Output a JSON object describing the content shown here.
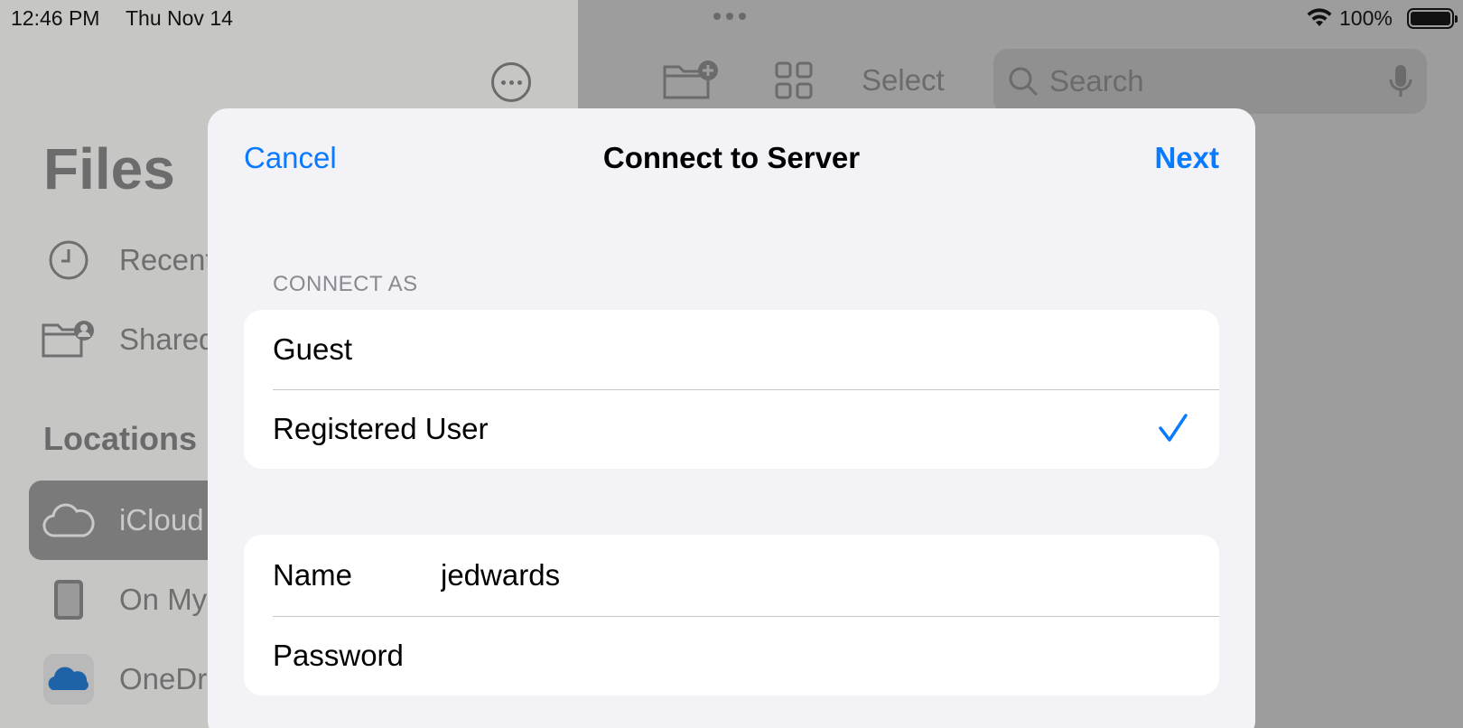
{
  "status_bar": {
    "time": "12:46 PM",
    "date": "Thu Nov 14",
    "battery": "100%"
  },
  "sidebar": {
    "title": "Files",
    "section_locations": "Locations",
    "items": [
      {
        "label": "Recents",
        "icon": "clock-icon"
      },
      {
        "label": "Shared",
        "icon": "shared-folder-icon"
      },
      {
        "label": "iCloud",
        "icon": "cloud-icon",
        "selected": true
      },
      {
        "label": "On My",
        "icon": "ipad-icon"
      },
      {
        "label": "OneDri",
        "icon": "onedrive-icon"
      }
    ]
  },
  "toolbar": {
    "select_label": "Select",
    "search_placeholder": "Search"
  },
  "dialog": {
    "title": "Connect to Server",
    "cancel_label": "Cancel",
    "next_label": "Next",
    "connect_as_header": "CONNECT AS",
    "connect_as_options": [
      {
        "label": "Guest",
        "selected": false
      },
      {
        "label": "Registered User",
        "selected": true
      }
    ],
    "name_label": "Name",
    "name_value": "jedwards",
    "password_label": "Password",
    "password_value": ""
  },
  "colors": {
    "accent": "#0a7aff",
    "dialog_bg": "#f2f2f7",
    "row_bg": "#ffffff"
  }
}
